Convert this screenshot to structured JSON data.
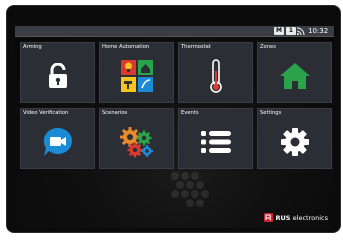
{
  "status_bar": {
    "badge_m": "M",
    "badge_1": "1",
    "time": "10:32",
    "wifi_icon": "wifi-icon"
  },
  "tiles": [
    {
      "label": "Arming",
      "icon": "unlocked-padlock-icon"
    },
    {
      "label": "Home Automation",
      "icon": "home-automation-icon"
    },
    {
      "label": "Thermostat",
      "icon": "thermometer-icon"
    },
    {
      "label": "Zones",
      "icon": "house-icon"
    },
    {
      "label": "Video Verification",
      "icon": "video-camera-icon"
    },
    {
      "label": "Scenarios",
      "icon": "gears-icon"
    },
    {
      "label": "Events",
      "icon": "list-icon"
    },
    {
      "label": "Settings",
      "icon": "gear-icon"
    }
  ],
  "brand": {
    "name": "RUS",
    "suffix": "electronics"
  },
  "colors": {
    "tile_bg": "#2b2e34",
    "green": "#2aa34a",
    "blue": "#1c8bd6",
    "orange": "#e8892b",
    "yellow": "#f5c41f",
    "red": "#d93a2f",
    "brand_red": "#c8242b"
  }
}
